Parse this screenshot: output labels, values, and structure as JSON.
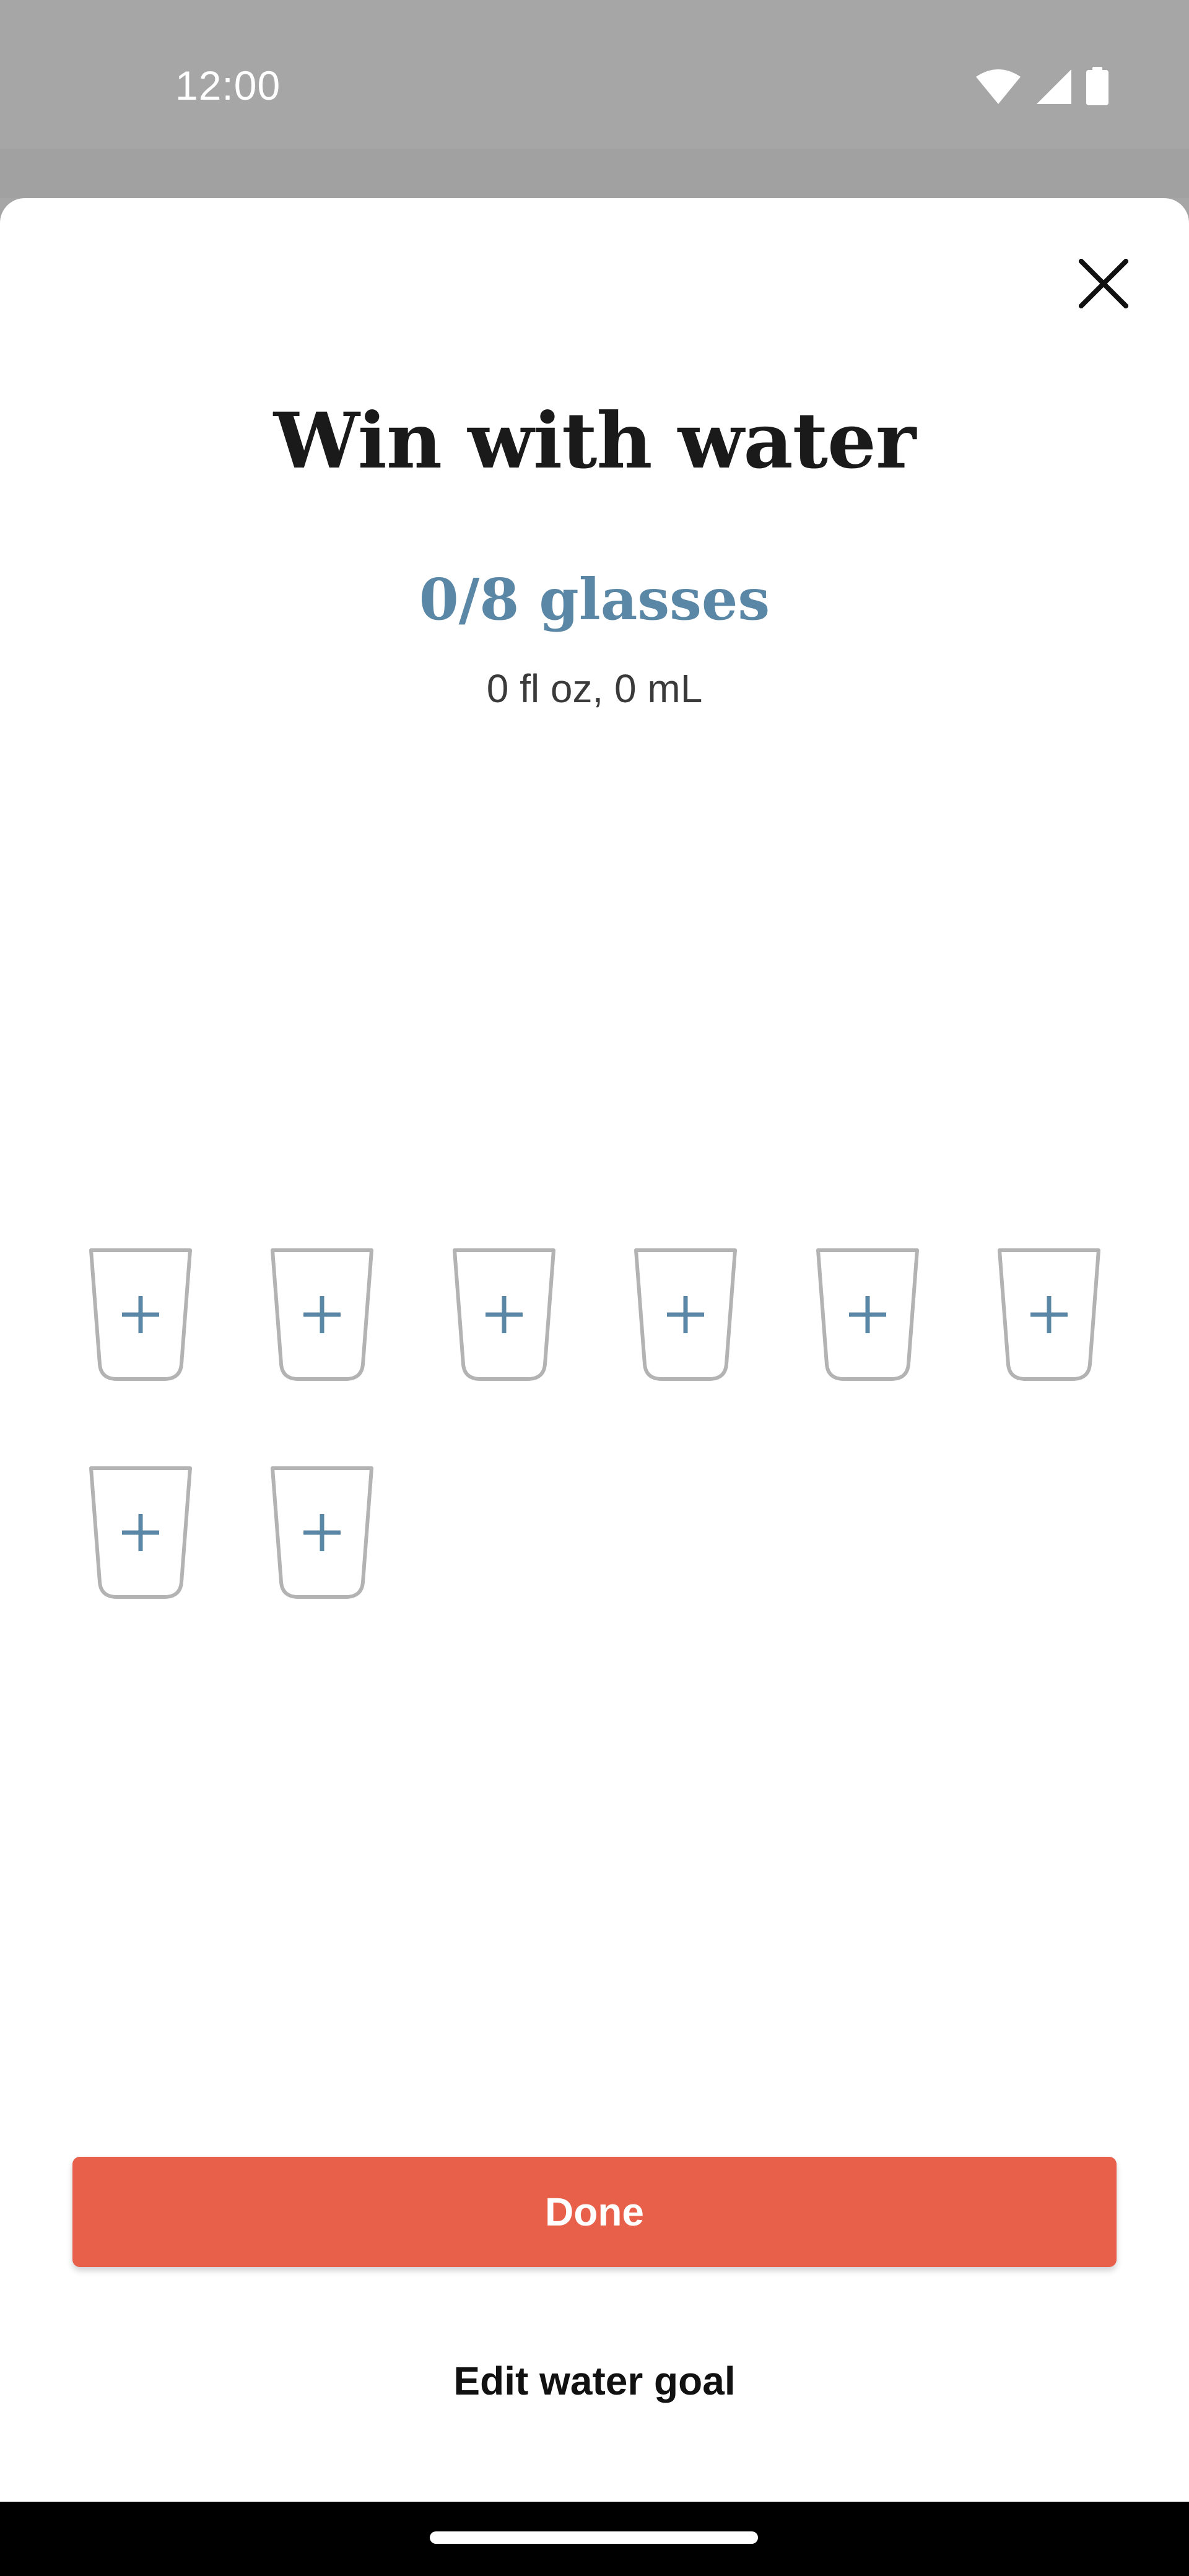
{
  "status_bar": {
    "time": "12:00",
    "icons": [
      "wifi-icon",
      "cellular-signal-icon",
      "battery-icon"
    ]
  },
  "sheet": {
    "close_icon": "close-icon",
    "title": "Win with water",
    "progress": "0/8 glasses",
    "volume": "0 fl oz, 0 mL",
    "glasses_total": 8,
    "glasses_filled": 0,
    "glass_icon": "add-glass-icon"
  },
  "actions": {
    "done_label": "Done",
    "edit_goal_label": "Edit water goal"
  },
  "colors": {
    "accent": "#e8604a",
    "progress_text": "#5a87a6",
    "plus": "#5a87a6",
    "glass_outline": "#b3b3b3"
  }
}
